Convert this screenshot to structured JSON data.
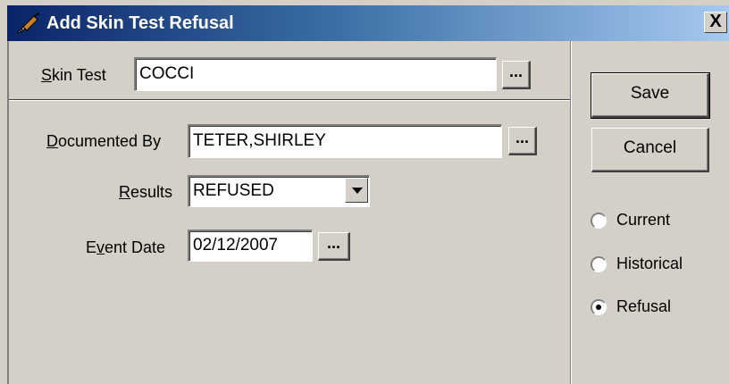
{
  "window": {
    "title": "Add Skin Test Refusal",
    "close_label": "X"
  },
  "form": {
    "skin_test": {
      "label_prefix": "",
      "label_mnemonic": "S",
      "label_rest": "kin Test",
      "value": "COCCI",
      "browse_label": "..."
    },
    "documented_by": {
      "label_mnemonic": "D",
      "label_rest": "ocumented By",
      "value": "TETER,SHIRLEY",
      "browse_label": "..."
    },
    "results": {
      "label_prefix": "",
      "label_mnemonic": "R",
      "label_rest": "esults",
      "selected": "REFUSED"
    },
    "event_date": {
      "label_prefix": "E",
      "label_mnemonic": "v",
      "label_rest": "ent Date",
      "value": "02/12/2007",
      "browse_label": "..."
    }
  },
  "actions": {
    "save_label": "Save",
    "cancel_label": "Cancel"
  },
  "view_options": {
    "current_label": "Current",
    "historical_label": "Historical",
    "refusal_label": "Refusal",
    "selected": "Refusal"
  },
  "icons": {
    "title_icon": "syringe-icon",
    "dropdown_icon": "chevron-down-icon"
  },
  "colors": {
    "title_gradient_start": "#0a246a",
    "title_gradient_end": "#a6caf0",
    "dialog_face": "#d4d0c8"
  }
}
